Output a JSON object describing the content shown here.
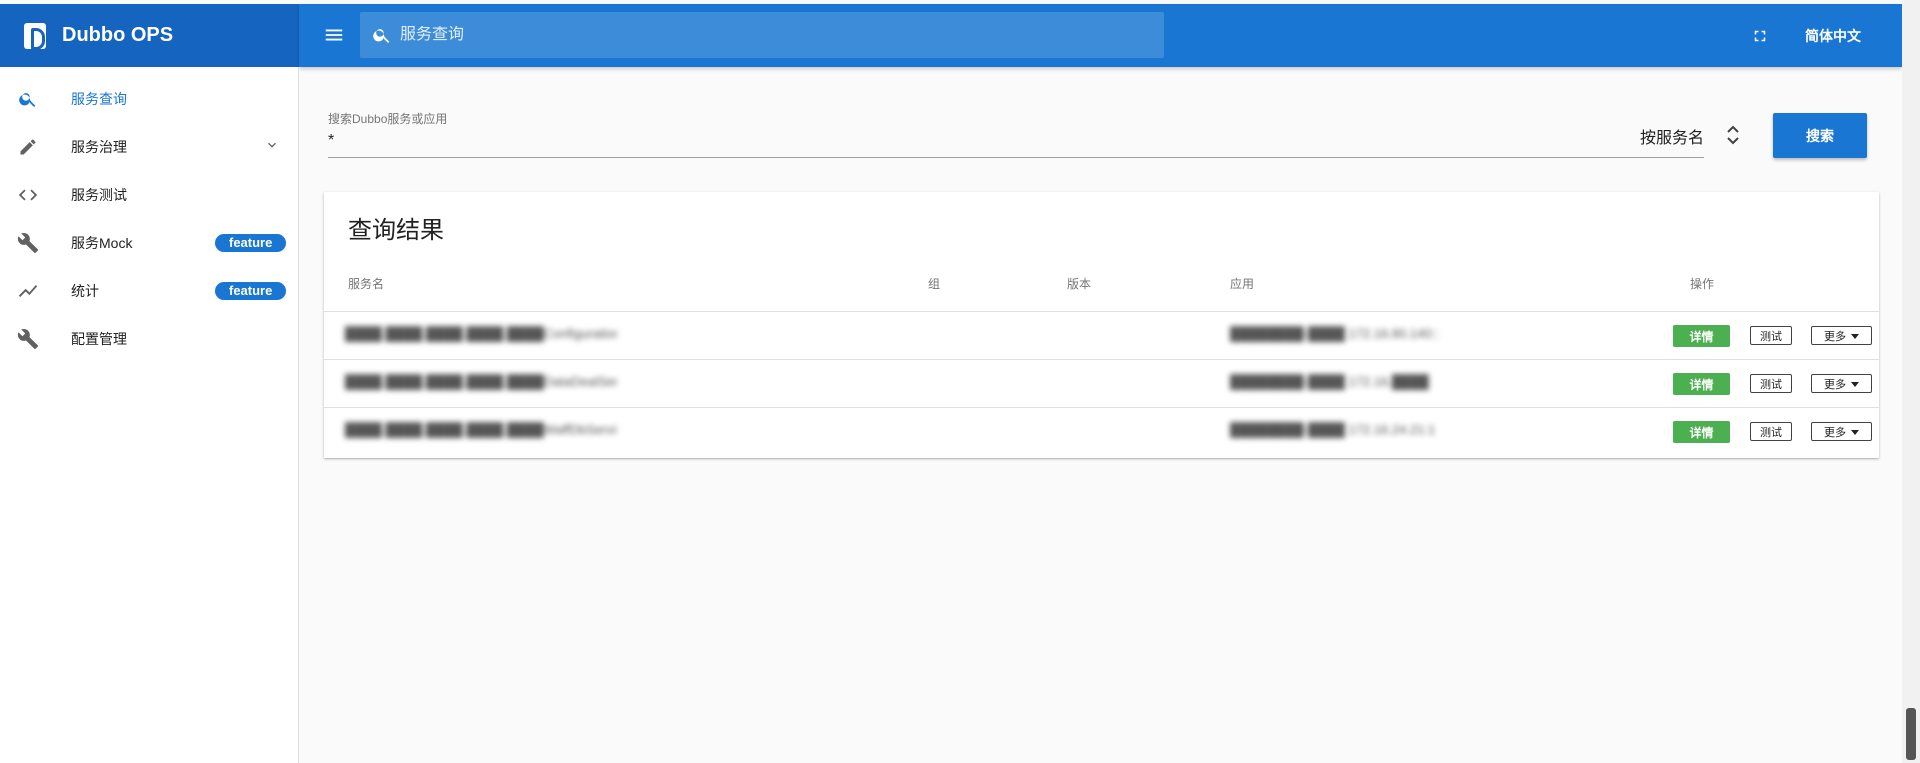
{
  "app": {
    "title": "Dubbo OPS"
  },
  "header": {
    "search_placeholder": "服务查询",
    "language": "简体中文"
  },
  "sidebar": {
    "items": [
      {
        "label": "服务查询",
        "icon": "search-icon",
        "active": true
      },
      {
        "label": "服务治理",
        "icon": "pencil-icon",
        "expandable": true
      },
      {
        "label": "服务测试",
        "icon": "code-icon"
      },
      {
        "label": "服务Mock",
        "icon": "wrench-icon",
        "badge": "feature"
      },
      {
        "label": "统计",
        "icon": "trending-icon",
        "badge": "feature"
      },
      {
        "label": "配置管理",
        "icon": "wrench-icon"
      }
    ]
  },
  "search": {
    "field_label": "搜索Dubbo服务或应用",
    "value": "*",
    "type_select": "按服务名",
    "button": "搜索"
  },
  "results": {
    "title": "查询结果",
    "columns": [
      "服务名",
      "组",
      "版本",
      "应用",
      "操作"
    ],
    "actions": {
      "detail": "详情",
      "test": "测试",
      "more": "更多"
    },
    "rows": [
      {
        "service": "████.████.████.████.████ConfigurationTaskService",
        "group": "",
        "version": "",
        "app": "████████-████ 172.16.80.140:1"
      },
      {
        "service": "████.████.████.████.████DataDealService",
        "group": "",
        "version": "",
        "app": "████████-████ 172.16.████"
      },
      {
        "service": "████.████.████.████.████WaffDbService",
        "group": "",
        "version": "",
        "app": "████████-████ 172.16.24.21:1"
      }
    ]
  }
}
